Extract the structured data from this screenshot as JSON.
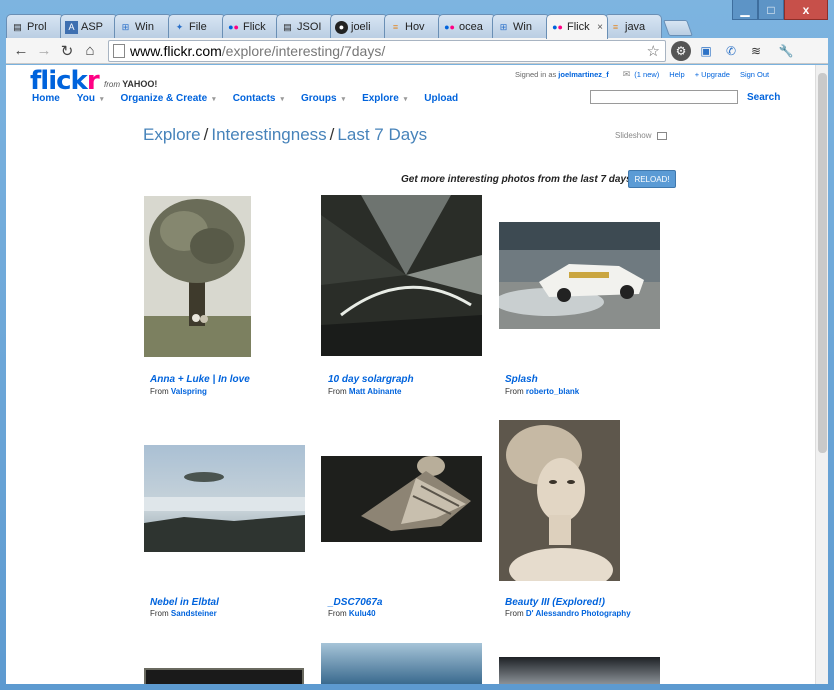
{
  "browser": {
    "tabs": [
      {
        "label": "Prol",
        "icon": "document-icon"
      },
      {
        "label": "ASP",
        "icon": "asp-icon"
      },
      {
        "label": "Win",
        "icon": "windows-icon"
      },
      {
        "label": "File",
        "icon": "file-icon"
      },
      {
        "label": "Flick",
        "icon": "flickr-icon"
      },
      {
        "label": "JSOI",
        "icon": "document-icon"
      },
      {
        "label": "joeli",
        "icon": "github-icon"
      },
      {
        "label": "Hov",
        "icon": "stackoverflow-icon"
      },
      {
        "label": "ocea",
        "icon": "flickr-icon"
      },
      {
        "label": "Win",
        "icon": "windows-icon"
      },
      {
        "label": "Flick",
        "icon": "flickr-icon",
        "active": true
      },
      {
        "label": "java",
        "icon": "stackoverflow-icon"
      }
    ],
    "url_host": "www.flickr.com",
    "url_path": "/explore/interesting/7days/",
    "close_glyph": "x",
    "tab_close_glyph": "×"
  },
  "flickr": {
    "logo_main": "flick",
    "logo_r": "r",
    "logo_from": "from",
    "logo_yahoo": "YAHOO!",
    "nav": [
      {
        "label": "Home",
        "caret": false
      },
      {
        "label": "You",
        "caret": true
      },
      {
        "label": "Organize & Create",
        "caret": true
      },
      {
        "label": "Contacts",
        "caret": true
      },
      {
        "label": "Groups",
        "caret": true
      },
      {
        "label": "Explore",
        "caret": true
      },
      {
        "label": "Upload",
        "caret": false
      }
    ],
    "caret_glyph": "▾",
    "signed_in_as": "Signed in as",
    "username": "joelmartinez_f",
    "mail_count": "(1 new)",
    "help": "Help",
    "upgrade": "+ Upgrade",
    "sign_out": "Sign Out",
    "search_label": "Search",
    "search_value": ""
  },
  "explore": {
    "crumb1": "Explore",
    "crumb2": "Interestingness",
    "crumb3": "Last 7 Days",
    "sep": "/",
    "slideshow": "Slideshow",
    "reload_text": "Get more interesting photos from the last 7 days",
    "reload_button": "RELOAD!",
    "from_label": "From",
    "photos": [
      {
        "title": "Anna + Luke | In love",
        "author": "Valspring"
      },
      {
        "title": "10 day solargraph",
        "author": "Matt Abinante"
      },
      {
        "title": "Splash",
        "author": "roberto_blank"
      },
      {
        "title": "Nebel in Elbtal",
        "author": "Sandsteiner"
      },
      {
        "title": "_DSC7067a",
        "author": "Kulu40"
      },
      {
        "title": "Beauty III (Explored!)",
        "author": "D' Alessandro Photography"
      }
    ]
  },
  "colors": {
    "flickr_blue": "#0063dc",
    "flickr_pink": "#ff0084",
    "reload_button": "#5b9bd5"
  }
}
